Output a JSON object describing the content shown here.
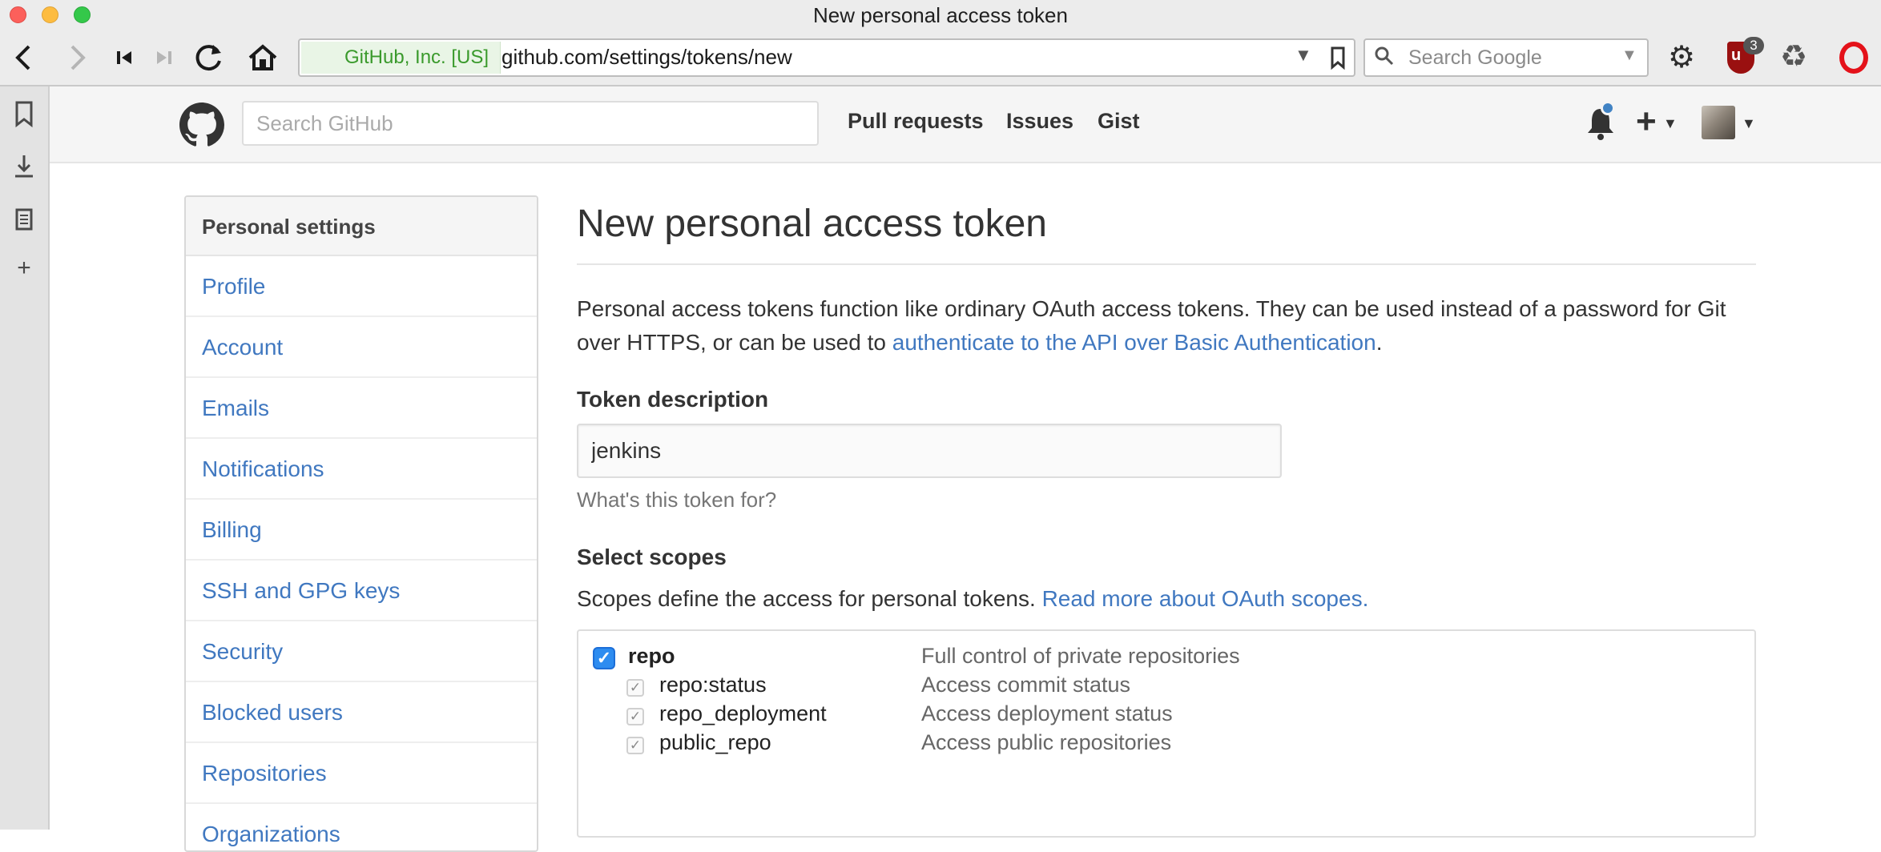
{
  "browser": {
    "window_title": "New personal access token",
    "identity": "GitHub, Inc. [US]",
    "url": "github.com/settings/tokens/new",
    "search_placeholder": "Search Google",
    "ublock_badge": "3"
  },
  "header": {
    "search_placeholder": "Search GitHub",
    "nav": [
      "Pull requests",
      "Issues",
      "Gist"
    ]
  },
  "menu": {
    "heading": "Personal settings",
    "items": [
      "Profile",
      "Account",
      "Emails",
      "Notifications",
      "Billing",
      "SSH and GPG keys",
      "Security",
      "Blocked users",
      "Repositories",
      "Organizations"
    ]
  },
  "main": {
    "title": "New personal access token",
    "intro_text": "Personal access tokens function like ordinary OAuth access tokens. They can be used instead of a password for Git over HTTPS, or can be used to ",
    "intro_link": "authenticate to the API over Basic Authentication",
    "intro_end": ".",
    "token_label": "Token description",
    "token_value": "jenkins",
    "token_hint": "What's this token for?",
    "scopes_label": "Select scopes",
    "scopes_text": "Scopes define the access for personal tokens. ",
    "scopes_link": "Read more about OAuth scopes.",
    "scopes": [
      {
        "name": "repo",
        "desc": "Full control of private repositories",
        "checked": true
      },
      {
        "name": "repo:status",
        "desc": "Access commit status",
        "checked": true
      },
      {
        "name": "repo_deployment",
        "desc": "Access deployment status",
        "checked": true
      },
      {
        "name": "public_repo",
        "desc": "Access public repositories",
        "checked": true
      }
    ]
  }
}
